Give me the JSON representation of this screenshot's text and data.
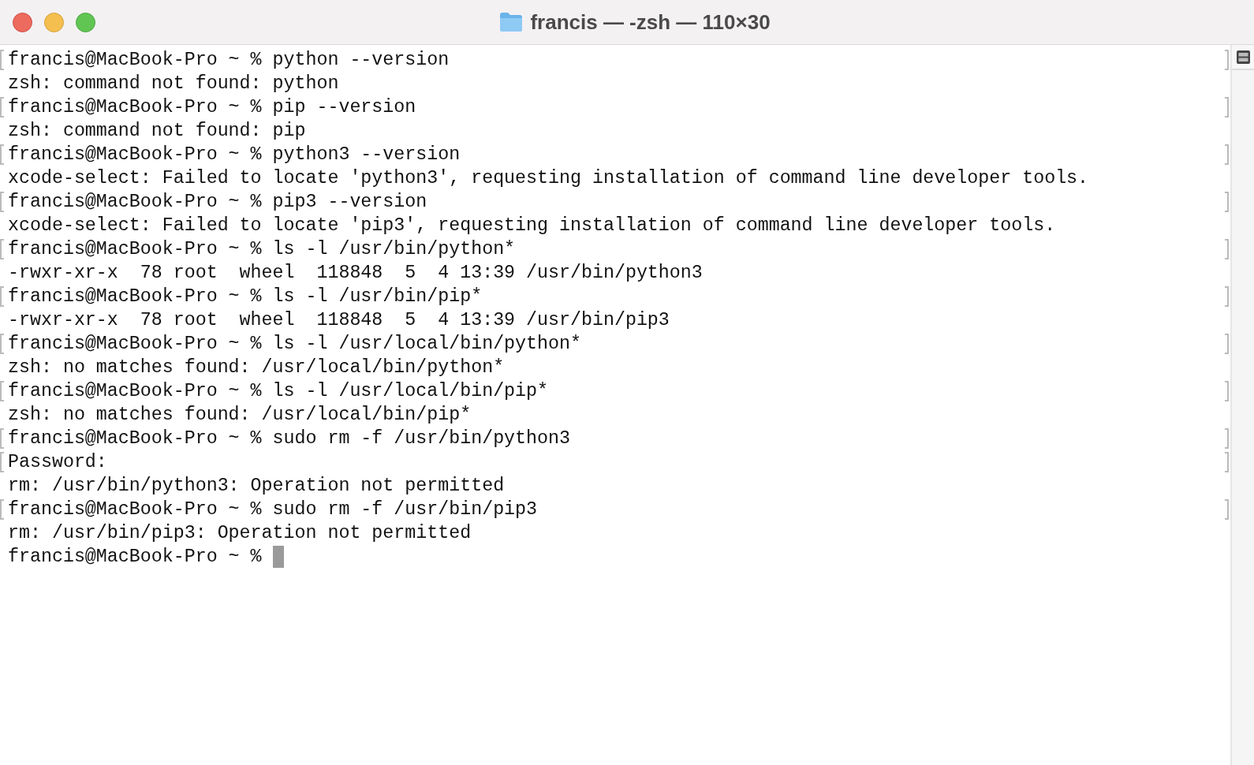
{
  "window": {
    "title": "francis — -zsh — 110×30"
  },
  "lines": [
    {
      "text": "francis@MacBook-Pro ~ % python --version",
      "marked": true
    },
    {
      "text": "zsh: command not found: python",
      "marked": false
    },
    {
      "text": "francis@MacBook-Pro ~ % pip --version",
      "marked": true
    },
    {
      "text": "zsh: command not found: pip",
      "marked": false
    },
    {
      "text": "francis@MacBook-Pro ~ % python3 --version",
      "marked": true
    },
    {
      "text": "xcode-select: Failed to locate 'python3', requesting installation of command line developer tools.",
      "marked": false
    },
    {
      "text": "francis@MacBook-Pro ~ % pip3 --version",
      "marked": true
    },
    {
      "text": "xcode-select: Failed to locate 'pip3', requesting installation of command line developer tools.",
      "marked": false
    },
    {
      "text": "francis@MacBook-Pro ~ % ls -l /usr/bin/python*",
      "marked": true
    },
    {
      "text": "-rwxr-xr-x  78 root  wheel  118848  5  4 13:39 /usr/bin/python3",
      "marked": false
    },
    {
      "text": "francis@MacBook-Pro ~ % ls -l /usr/bin/pip*",
      "marked": true
    },
    {
      "text": "-rwxr-xr-x  78 root  wheel  118848  5  4 13:39 /usr/bin/pip3",
      "marked": false
    },
    {
      "text": "francis@MacBook-Pro ~ % ls -l /usr/local/bin/python*",
      "marked": true
    },
    {
      "text": "zsh: no matches found: /usr/local/bin/python*",
      "marked": false
    },
    {
      "text": "francis@MacBook-Pro ~ % ls -l /usr/local/bin/pip*",
      "marked": true
    },
    {
      "text": "zsh: no matches found: /usr/local/bin/pip*",
      "marked": false
    },
    {
      "text": "francis@MacBook-Pro ~ % sudo rm -f /usr/bin/python3",
      "marked": true
    },
    {
      "text": "Password:",
      "marked": true
    },
    {
      "text": "rm: /usr/bin/python3: Operation not permitted",
      "marked": false
    },
    {
      "text": "francis@MacBook-Pro ~ % sudo rm -f /usr/bin/pip3",
      "marked": true
    },
    {
      "text": "rm: /usr/bin/pip3: Operation not permitted",
      "marked": false
    }
  ],
  "prompt": {
    "text": "francis@MacBook-Pro ~ %",
    "cursor": true
  }
}
